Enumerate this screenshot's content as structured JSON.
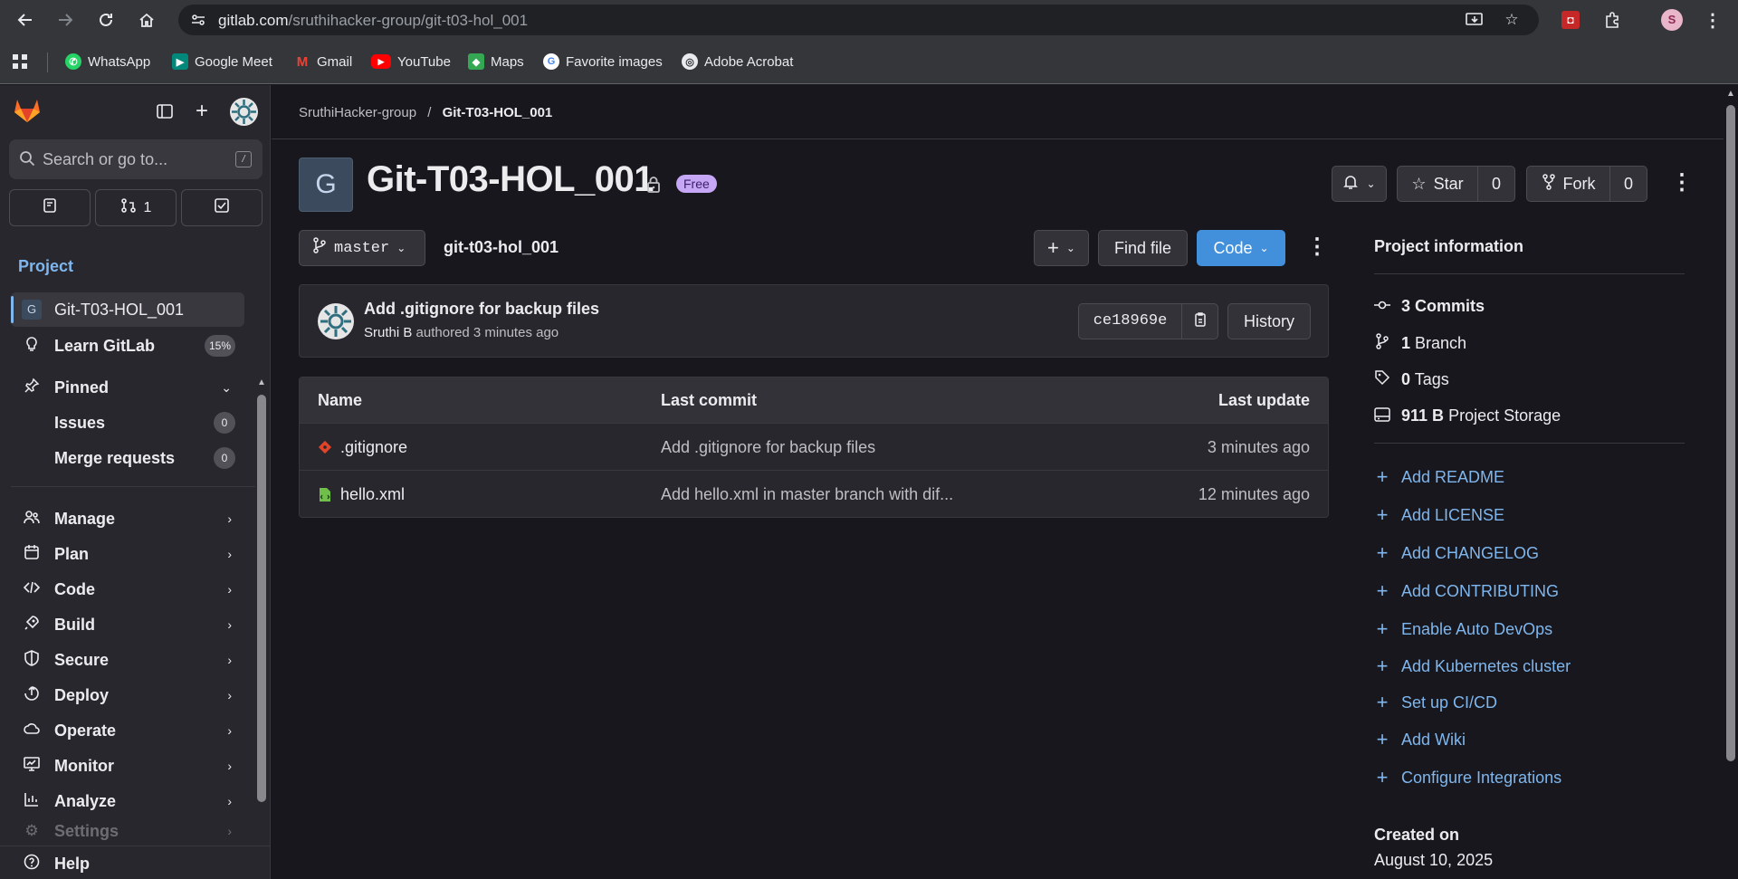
{
  "browser": {
    "url_host": "gitlab.com",
    "url_path": "/sruthihacker-group/git-t03-hol_001",
    "profile_initial": "S",
    "bookmarks": [
      {
        "label": "WhatsApp",
        "icon": "whatsapp-icon",
        "color": "#25d366"
      },
      {
        "label": "Google Meet",
        "icon": "google-meet-icon",
        "color": "#00897b"
      },
      {
        "label": "Gmail",
        "icon": "gmail-icon",
        "color": "#ea4335"
      },
      {
        "label": "YouTube",
        "icon": "youtube-icon",
        "color": "#ff0000"
      },
      {
        "label": "Maps",
        "icon": "maps-icon",
        "color": "#34a853"
      },
      {
        "label": "Favorite images",
        "icon": "google-icon",
        "color": "#4285f4"
      },
      {
        "label": "Adobe Acrobat",
        "icon": "globe-icon",
        "color": "#5f6368"
      }
    ]
  },
  "sidebar": {
    "search_placeholder": "Search or go to...",
    "search_shortcut": "/",
    "mr_count": "1",
    "section_title": "Project",
    "project_avatar_letter": "G",
    "items": [
      {
        "label": "Git-T03-HOL_001",
        "badge": ""
      },
      {
        "label": "Learn GitLab",
        "badge": "15%"
      },
      {
        "label": "Pinned",
        "badge": ""
      },
      {
        "label": "Issues",
        "badge": "0"
      },
      {
        "label": "Merge requests",
        "badge": "0"
      },
      {
        "label": "Manage"
      },
      {
        "label": "Plan"
      },
      {
        "label": "Code"
      },
      {
        "label": "Build"
      },
      {
        "label": "Secure"
      },
      {
        "label": "Deploy"
      },
      {
        "label": "Operate"
      },
      {
        "label": "Monitor"
      },
      {
        "label": "Analyze"
      },
      {
        "label": "Settings"
      }
    ],
    "help_label": "Help"
  },
  "breadcrumb": {
    "group": "SruthiHacker-group",
    "separator": "/",
    "project": "Git-T03-HOL_001"
  },
  "project": {
    "avatar_letter": "G",
    "title": "Git-T03-HOL_001",
    "plan_badge": "Free",
    "star_label": "Star",
    "star_count": "0",
    "fork_label": "Fork",
    "fork_count": "0",
    "branch": "master",
    "path": "git-t03-hol_001",
    "find_file_label": "Find file",
    "code_label": "Code"
  },
  "last_commit": {
    "title": "Add .gitignore for backup files",
    "author": "Sruthi B",
    "authored_text": "authored 3 minutes ago",
    "sha": "ce18969e",
    "history_label": "History"
  },
  "files": {
    "headers": [
      "Name",
      "Last commit",
      "Last update"
    ],
    "rows": [
      {
        "name": ".gitignore",
        "icon": "git-file-icon",
        "commit": "Add .gitignore for backup files",
        "updated": "3 minutes ago"
      },
      {
        "name": "hello.xml",
        "icon": "xml-file-icon",
        "commit": "Add hello.xml in master branch with dif...",
        "updated": "12 minutes ago"
      }
    ]
  },
  "project_info": {
    "title": "Project information",
    "stats": [
      {
        "value": "3",
        "label": "Commits"
      },
      {
        "value": "1",
        "label": "Branch"
      },
      {
        "value": "0",
        "label": "Tags"
      },
      {
        "value": "911 B",
        "label": "Project Storage"
      }
    ],
    "links": [
      "Add README",
      "Add LICENSE",
      "Add CHANGELOG",
      "Add CONTRIBUTING",
      "Enable Auto DevOps",
      "Add Kubernetes cluster",
      "Set up CI/CD",
      "Add Wiki",
      "Configure Integrations"
    ],
    "created_label": "Created on",
    "created_date": "August 10, 2025"
  },
  "colors": {
    "accent_blue": "#428fdc",
    "link_blue": "#7fb6ed",
    "gitlab_orange": "#fc6d26",
    "free_badge": "#c6a7f5"
  }
}
